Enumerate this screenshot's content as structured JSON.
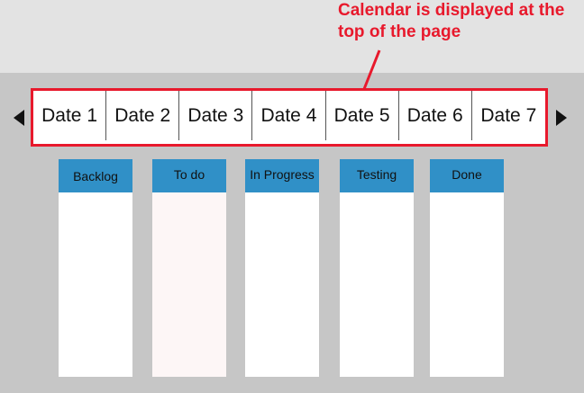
{
  "annotation": {
    "text_line1": "Calendar is displayed at the",
    "text_line2": "top of the page",
    "color": "#e8192c"
  },
  "calendar": {
    "prev_icon": "triangle-left-icon",
    "next_icon": "triangle-right-icon",
    "dates": [
      "Date 1",
      "Date 2",
      "Date 3",
      "Date 4",
      "Date 5",
      "Date 6",
      "Date 7"
    ]
  },
  "board": {
    "header_color": "#3090c7",
    "columns": [
      {
        "label": "Backlog"
      },
      {
        "label": "To do"
      },
      {
        "label": "In Progress"
      },
      {
        "label": "Testing"
      },
      {
        "label": "Done"
      }
    ]
  }
}
